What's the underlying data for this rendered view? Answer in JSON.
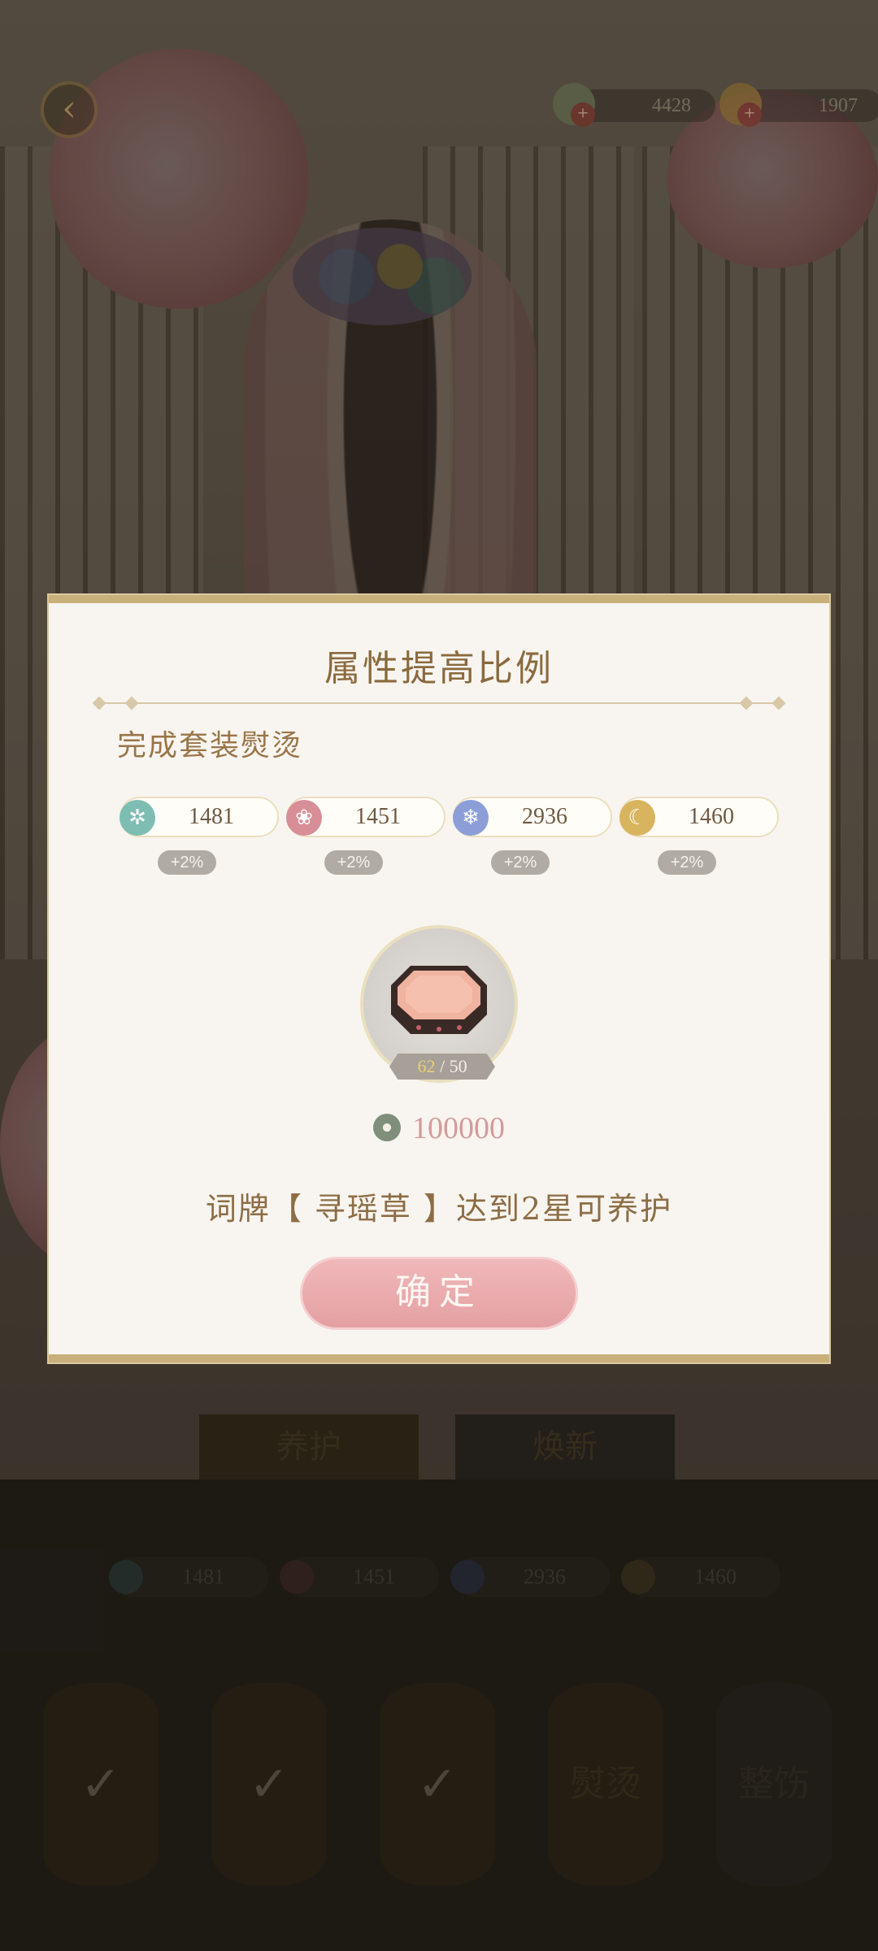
{
  "header": {
    "currencies": [
      {
        "name": "jade-coin",
        "value": "4428"
      },
      {
        "name": "gold-ingot",
        "value": "1907"
      }
    ]
  },
  "dialog": {
    "title": "属性提高比例",
    "subtitle": "完成套装熨烫",
    "stats": [
      {
        "icon": "teal-swirl-icon",
        "value": "1481",
        "bonus": "+2%",
        "color": "#7ebdb2"
      },
      {
        "icon": "pink-lotus-icon",
        "value": "1451",
        "bonus": "+2%",
        "color": "#d88e96"
      },
      {
        "icon": "blue-snowflake-icon",
        "value": "2936",
        "bonus": "+2%",
        "color": "#8c9ed8"
      },
      {
        "icon": "gold-moon-icon",
        "value": "1460",
        "bonus": "+2%",
        "color": "#d9b45e"
      }
    ],
    "item": {
      "have": "62",
      "separator": " / ",
      "need": "50"
    },
    "cost": "100000",
    "hint": "词牌【 寻瑶草 】达到2星可养护",
    "confirm_label": "确定"
  },
  "lower": {
    "tabs": [
      "养护",
      "焕新"
    ],
    "stats": [
      "1481",
      "1451",
      "2936",
      "1460"
    ],
    "slots": [
      "",
      "",
      "",
      "熨烫",
      "整饬"
    ]
  },
  "colors": {
    "accent_gold": "#c9b07a",
    "button_pink": "#e4a0a3",
    "title_brown": "#8a6a3e"
  }
}
